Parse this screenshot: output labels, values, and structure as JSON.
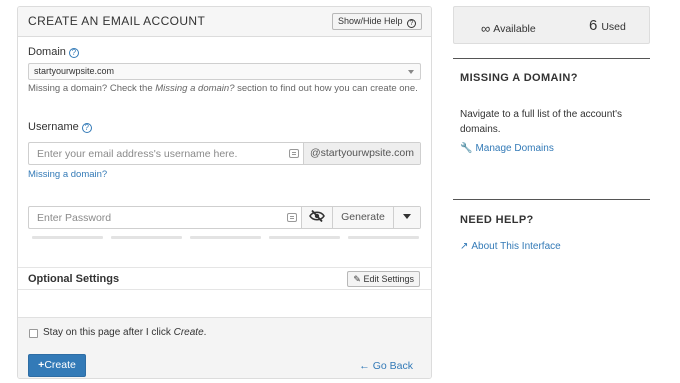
{
  "form": {
    "title": "CREATE AN EMAIL ACCOUNT",
    "help_button": "Show/Hide Help",
    "domain_label": "Domain",
    "domain_value": "startyourwpsite.com",
    "domain_hint_prefix": "Missing a domain? Check the ",
    "domain_hint_italic": "Missing a domain?",
    "domain_hint_suffix": " section to find out how you can create one.",
    "username_label": "Username",
    "username_placeholder": "Enter your email address's username here.",
    "username_suffix": "@startyourwpsite.com",
    "missing_domain_link": "Missing a domain?",
    "password_placeholder": "Enter Password",
    "generate_label": "Generate",
    "optional_settings_title": "Optional Settings",
    "edit_settings_label": "Edit Settings",
    "stay_label_prefix": "Stay on this page after I click ",
    "stay_label_italic": "Create",
    "stay_label_suffix": ".",
    "create_label": "Create",
    "go_back_label": "Go Back"
  },
  "stats": {
    "available_symbol": "∞",
    "available_label": "Available",
    "used_count": "6",
    "used_label": "Used"
  },
  "sidebar": {
    "missing_title": "MISSING A DOMAIN?",
    "missing_text": "Navigate to a full list of the account's domains.",
    "manage_link": "Manage Domains",
    "help_title": "NEED HELP?",
    "about_link": "About This Interface"
  },
  "icons": {
    "help": "question-circle-icon",
    "keyboard": "keyboard-icon",
    "eye": "eye-slash-icon",
    "caret": "caret-down-icon",
    "pencil": "pencil-icon",
    "plus": "plus-icon",
    "back": "arrow-left-icon",
    "wrench": "wrench-icon",
    "external": "external-link-icon"
  },
  "colors": {
    "primary": "#337ab7",
    "header_bg": "#f6f6f6"
  }
}
